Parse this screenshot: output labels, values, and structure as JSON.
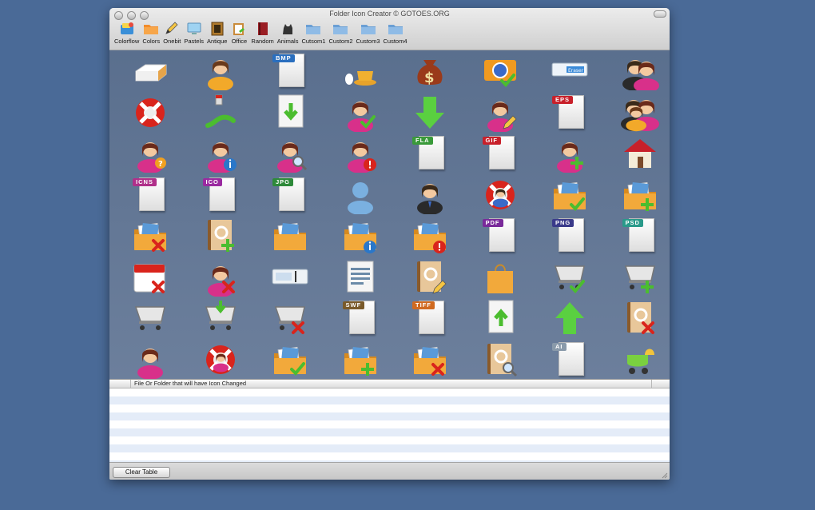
{
  "window": {
    "title": "Folder Icon Creator © GOTOES.ORG"
  },
  "toolbar": {
    "items": [
      {
        "label": "Colorflow",
        "icon": "colorflow-icon"
      },
      {
        "label": "Colors",
        "icon": "colors-folder-icon"
      },
      {
        "label": "Onebit",
        "icon": "pencil-icon"
      },
      {
        "label": "Pastels",
        "icon": "pastel-monitor-icon"
      },
      {
        "label": "Antique",
        "icon": "antique-frame-icon"
      },
      {
        "label": "Office",
        "icon": "office-clipboard-icon"
      },
      {
        "label": "Random",
        "icon": "book-icon"
      },
      {
        "label": "Animals",
        "icon": "cat-icon"
      },
      {
        "label": "Cutsom1",
        "icon": "folder-icon"
      },
      {
        "label": "Custom2",
        "icon": "folder-icon"
      },
      {
        "label": "Custom3",
        "icon": "folder-icon"
      },
      {
        "label": "Custom4",
        "icon": "folder-icon"
      }
    ]
  },
  "icon_grid": {
    "rows": [
      [
        "eraser-icon",
        "user-icon",
        "bmp-file-icon",
        "coffee-egg-icon",
        "money-bag-icon",
        "camera-check-icon",
        "eraser-card-icon",
        "users-couple-icon"
      ],
      [
        "lifebuoy-icon",
        "pen-stroke-icon",
        "download-file-icon",
        "user-female-check-icon",
        "down-arrow-icon",
        "user-female-edit-icon",
        "eps-file-icon",
        "family-icon"
      ],
      [
        "user-female-help-icon",
        "user-female-info-icon",
        "user-female-search-icon",
        "user-female-warning-icon",
        "fla-file-icon",
        "gif-file-icon",
        "user-female-add-icon",
        "home-icon"
      ],
      [
        "icns-file-icon",
        "ico-file-icon",
        "jpg-file-icon",
        "user-silhouette-icon",
        "businessman-icon",
        "support-lifebuoy-icon",
        "folder-check-icon",
        "folder-add-icon"
      ],
      [
        "folder-delete-icon",
        "address-book-add-icon",
        "folder-open-icon",
        "folder-info-icon",
        "folder-warning-icon",
        "pdf-file-icon",
        "png-file-icon",
        "psd-file-icon"
      ],
      [
        "calendar-delete-icon",
        "user-female-delete-icon",
        "text-field-icon",
        "document-list-icon",
        "address-book-edit-icon",
        "shopping-bag-icon",
        "cart-check-icon",
        "cart-add-icon"
      ],
      [
        "cart-empty-icon",
        "cart-download-icon",
        "cart-delete-icon",
        "swf-file-icon",
        "tiff-file-icon",
        "upload-file-icon",
        "up-arrow-icon",
        "address-book-delete-icon"
      ],
      [
        "user-female-icon",
        "support-person-icon",
        "folder-check-icon",
        "folder-add-icon",
        "folder-delete-icon",
        "address-book-search-icon",
        "ai-file-icon",
        "stroller-add-icon"
      ]
    ],
    "file_tags": {
      "bmp": "BMP",
      "eps": "EPS",
      "fla": "FLA",
      "gif": "GIF",
      "icns": "ICNS",
      "ico": "ICO",
      "jpg": "JPG",
      "pdf": "PDF",
      "png": "PNG",
      "psd": "PSD",
      "swf": "SWF",
      "tiff": "TIFF",
      "ai": "AI"
    },
    "eraser_card_text": "Eraser"
  },
  "table": {
    "column_header": "File Or Folder that will have Icon Changed",
    "rows": []
  },
  "bottom": {
    "clear_button": "Clear Table"
  },
  "colors": {
    "desktop": "#4a6a97",
    "grid_background": "#5a6f8e",
    "folder": "#f2a93b",
    "red_badge": "#d9241c",
    "green_badge": "#4bbd2f",
    "blue_badge": "#2a77c9"
  }
}
